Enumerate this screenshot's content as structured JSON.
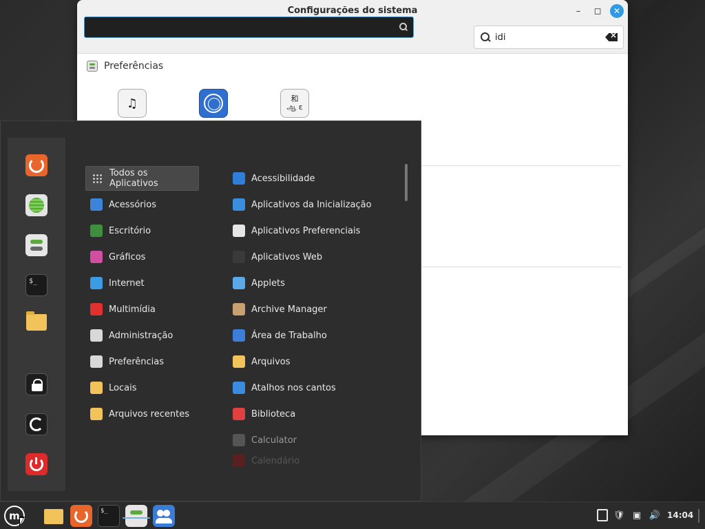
{
  "settings_window": {
    "title": "Configurações do sistema",
    "search_value": "idi",
    "section_label": "Preferências",
    "pref_icon_c_text": "和\nஅ ε"
  },
  "menu": {
    "search_value": "",
    "categories": [
      {
        "label": "Todos os Aplicativos",
        "icon": "grid-icon",
        "color": "#dddddd"
      },
      {
        "label": "Acessórios",
        "icon": "scissors-icon",
        "color": "#3b84d9"
      },
      {
        "label": "Escritório",
        "icon": "office-icon",
        "color": "#3d8f3d"
      },
      {
        "label": "Gráficos",
        "icon": "graphics-icon",
        "color": "#d04fa0"
      },
      {
        "label": "Internet",
        "icon": "cloud-icon",
        "color": "#3b9be3"
      },
      {
        "label": "Multimídia",
        "icon": "play-icon",
        "color": "#e03030"
      },
      {
        "label": "Administração",
        "icon": "admin-icon",
        "color": "#d8d8d8"
      },
      {
        "label": "Preferências",
        "icon": "preferences-icon",
        "color": "#d8d8d8"
      },
      {
        "label": "Locais",
        "icon": "folder-icon",
        "color": "#f2c35a"
      },
      {
        "label": "Arquivos recentes",
        "icon": "recent-folder-icon",
        "color": "#f2c35a"
      }
    ],
    "apps": [
      {
        "label": "Acessibilidade",
        "icon": "accessibility-icon",
        "color": "#2f7fd8"
      },
      {
        "label": "Aplicativos da Inicialização",
        "icon": "startup-apps-icon",
        "color": "#3a8ee0"
      },
      {
        "label": "Aplicativos Preferenciais",
        "icon": "preferred-apps-icon",
        "color": "#e6e6e6"
      },
      {
        "label": "Aplicativos Web",
        "icon": "web-apps-icon",
        "color": "#3a3a3a"
      },
      {
        "label": "Applets",
        "icon": "applets-icon",
        "color": "#5aa9e8"
      },
      {
        "label": "Archive Manager",
        "icon": "archive-icon",
        "color": "#c9a070"
      },
      {
        "label": "Área de Trabalho",
        "icon": "desktop-icon",
        "color": "#3b7fd8"
      },
      {
        "label": "Arquivos",
        "icon": "files-folder-icon",
        "color": "#f2c35a"
      },
      {
        "label": "Atalhos nos cantos",
        "icon": "hot-corners-icon",
        "color": "#3b8be0"
      },
      {
        "label": "Biblioteca",
        "icon": "library-icon",
        "color": "#e04040"
      },
      {
        "label": "Calculator",
        "icon": "calculator-icon",
        "color": "#555555"
      },
      {
        "label": "Calendário",
        "icon": "calendar-icon",
        "color": "#5a2020"
      }
    ]
  },
  "taskbar": {
    "clock": "14:04",
    "mint_letter": "m",
    "terminal_glyph": "$_"
  }
}
